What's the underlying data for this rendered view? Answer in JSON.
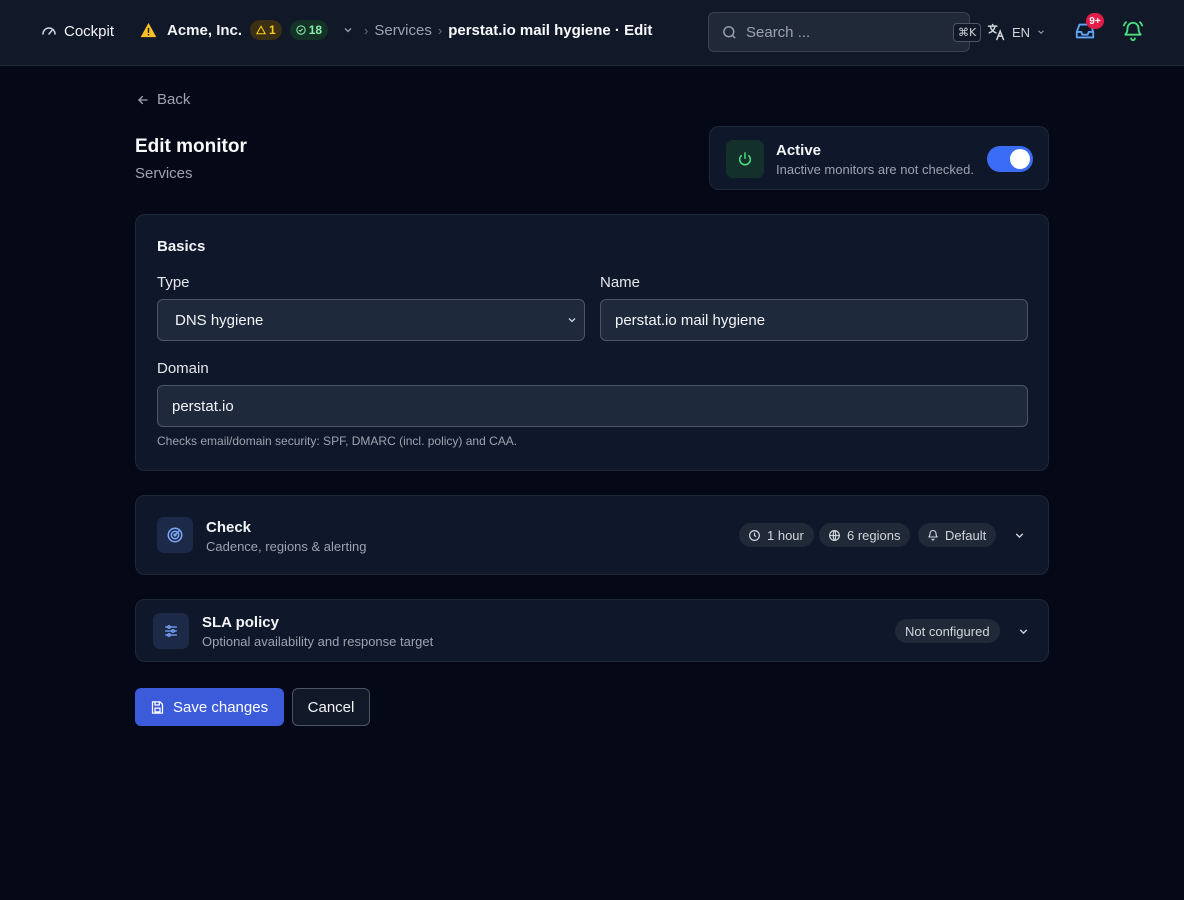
{
  "colors": {
    "background": "#050816",
    "topbar": "#111827",
    "card": "#0f172a",
    "accent": "#3b5bdb",
    "toggle_on": "#3b6cf6",
    "warning": "#facc15",
    "success": "#86efac",
    "danger": "#e11d48"
  },
  "topbar": {
    "app_name": "Cockpit",
    "org": {
      "name": "Acme, Inc.",
      "warning_count": "1",
      "ok_count": "18"
    },
    "breadcrumb": {
      "parent": "Services",
      "current": "perstat.io mail hygiene · Edit"
    },
    "search": {
      "placeholder": "Search ...",
      "shortcut": "⌘K"
    },
    "language": "EN",
    "inbox_badge": "9+"
  },
  "page": {
    "back_label": "Back",
    "title": "Edit monitor",
    "subtitle": "Services"
  },
  "active": {
    "title": "Active",
    "description": "Inactive monitors are not checked.",
    "enabled": true
  },
  "basics": {
    "title": "Basics",
    "type_label": "Type",
    "type_value": "DNS hygiene",
    "name_label": "Name",
    "name_value": "perstat.io mail hygiene",
    "domain_label": "Domain",
    "domain_value": "perstat.io",
    "help_text": "Checks email/domain security: SPF, DMARC (incl. policy) and CAA."
  },
  "check_section": {
    "title": "Check",
    "description": "Cadence, regions & alerting",
    "chips": {
      "interval": "1 hour",
      "regions": "6 regions",
      "alerting": "Default"
    }
  },
  "sla_section": {
    "title": "SLA policy",
    "description": "Optional availability and response target",
    "status": "Not configured"
  },
  "actions": {
    "save_label": "Save changes",
    "cancel_label": "Cancel"
  }
}
